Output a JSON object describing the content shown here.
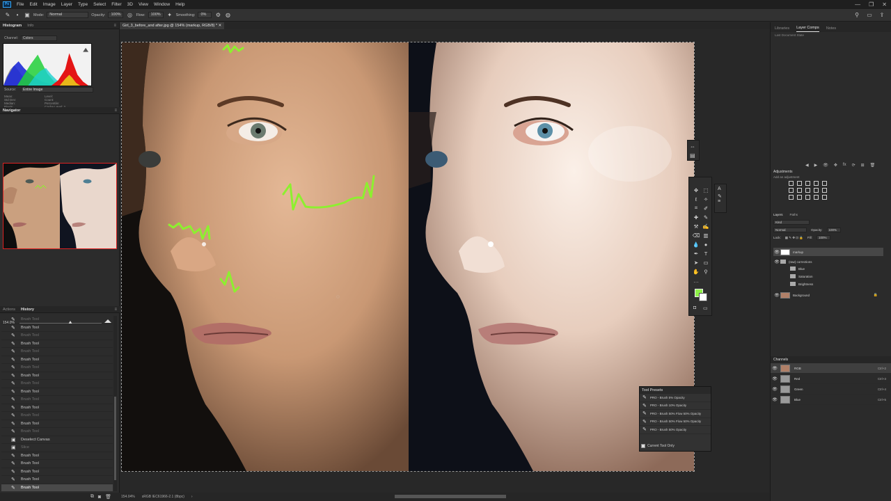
{
  "menubar": {
    "logo": "Ps",
    "items": [
      "File",
      "Edit",
      "Image",
      "Layer",
      "Type",
      "Select",
      "Filter",
      "3D",
      "View",
      "Window",
      "Help"
    ]
  },
  "optbar": {
    "mode_label": "Mode:",
    "mode_value": "Normal",
    "opacity_label": "Opacity:",
    "opacity_value": "100%",
    "flow_label": "Flow:",
    "flow_value": "100%",
    "smoothing_label": "Smoothing:",
    "smoothing_value": "0%"
  },
  "histogram_panel": {
    "tabs": [
      "Histogram",
      "Info"
    ],
    "channel_label": "Channel:",
    "channel_value": "Colors",
    "source_label": "Source:",
    "source_value": "Entire Image",
    "stats": [
      [
        "Mean:",
        "Level:"
      ],
      [
        "Std Dev:",
        "Count:"
      ],
      [
        "Median:",
        "Percentile:"
      ],
      [
        "Pixels:",
        "Cache Level: 2"
      ]
    ]
  },
  "navigator_panel": {
    "title": "Navigator",
    "zoom": "154.0%"
  },
  "history_panel": {
    "tabs": [
      "Actions",
      "History"
    ],
    "items": [
      {
        "label": "Brush Tool",
        "dim": true
      },
      {
        "label": "Brush Tool",
        "dim": false
      },
      {
        "label": "Brush Tool",
        "dim": true
      },
      {
        "label": "Brush Tool",
        "dim": false
      },
      {
        "label": "Brush Tool",
        "dim": true
      },
      {
        "label": "Brush Tool",
        "dim": false
      },
      {
        "label": "Brush Tool",
        "dim": true
      },
      {
        "label": "Brush Tool",
        "dim": false
      },
      {
        "label": "Brush Tool",
        "dim": true
      },
      {
        "label": "Brush Tool",
        "dim": false
      },
      {
        "label": "Brush Tool",
        "dim": true
      },
      {
        "label": "Brush Tool",
        "dim": false
      },
      {
        "label": "Brush Tool",
        "dim": true
      },
      {
        "label": "Brush Tool",
        "dim": false
      },
      {
        "label": "Brush Tool",
        "dim": true
      },
      {
        "label": "Deselect Canvas",
        "dim": false
      },
      {
        "label": "Slice",
        "dim": true
      },
      {
        "label": "Brush Tool",
        "dim": false
      },
      {
        "label": "Brush Tool",
        "dim": false
      },
      {
        "label": "Brush Tool",
        "dim": false
      },
      {
        "label": "Brush Tool",
        "dim": false
      },
      {
        "label": "Brush Tool",
        "dim": false
      }
    ]
  },
  "document": {
    "tab_title": "Girl_3_before_and after.jpg @ 154% (markup, RGB/8) *",
    "status_zoom": "154.04%",
    "status_profile": "sRGB IEC61966-2.1 (8bpc)"
  },
  "tool_presets": {
    "title": "Tool Presets",
    "items": [
      "PRO - Brush 5% Opacity",
      "PRO - Brush 10% Opacity",
      "PRO - Brush 50% Flow 50% Opacity",
      "PRO - Brush 50% Flow 50% Opacity",
      "PRO - Brush 50% Opacity"
    ],
    "footer": "Current Tool Only"
  },
  "right_panel": {
    "tabs": [
      "Libraries",
      "Layer Comps",
      "Notes"
    ],
    "comp_text": "Last Document State",
    "adjust_title": "Adjustments",
    "adjust_sub": "Add an adjustment",
    "layer_tabs": [
      "Layers",
      "Paths"
    ],
    "kind": "Kind",
    "blend": "Normal",
    "opacity_label": "Opacity:",
    "opacity": "100%",
    "lock_label": "Lock:",
    "fill_label": "Fill:",
    "fill": "100%",
    "layers": [
      {
        "name": "markup",
        "type": "layer",
        "eye": true,
        "selected": true
      },
      {
        "name": "(raw) corrections",
        "type": "group",
        "eye": true,
        "selected": false
      },
      {
        "name": "Blue",
        "type": "group",
        "eye": false,
        "selected": false
      },
      {
        "name": "Saturation",
        "type": "group",
        "eye": false,
        "selected": false
      },
      {
        "name": "Brightness",
        "type": "group",
        "eye": false,
        "selected": false
      },
      {
        "name": "Background",
        "type": "bg",
        "eye": true,
        "selected": false
      }
    ],
    "channels_title": "Channels",
    "channels": [
      {
        "name": "RGB",
        "shortcut": "Ctrl+2"
      },
      {
        "name": "Red",
        "shortcut": "Ctrl+3"
      },
      {
        "name": "Green",
        "shortcut": "Ctrl+4"
      },
      {
        "name": "Blue",
        "shortcut": "Ctrl+5"
      }
    ]
  },
  "colors": {
    "foreground": "#8ef248",
    "background": "#ffffff",
    "markup_stroke": "#8df02f",
    "accent": "#31a8ff"
  }
}
